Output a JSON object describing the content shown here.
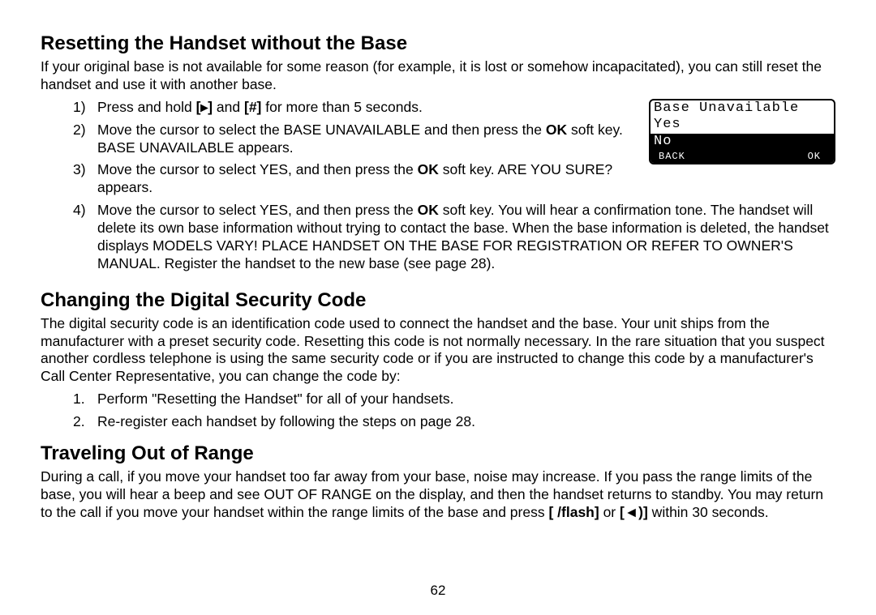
{
  "section1": {
    "heading": "Resetting the Handset without the Base",
    "intro": "If your original base is not available for some reason (for example, it is lost or somehow incapacitated), you can still reset the handset and use it with another base.",
    "steps": [
      {
        "num": "1)",
        "pre": "Press and hold ",
        "icon1": "[▸]",
        "mid": " and ",
        "icon2": "[#]",
        "post": " for more than 5 seconds."
      },
      {
        "num": "2)",
        "text_a": "Move the cursor to select the BASE UNAVAILABLE and then press the ",
        "bold_a": "OK",
        "text_b": " soft key. BASE UNAVAILABLE appears."
      },
      {
        "num": "3)",
        "text_a": "Move the cursor to select YES, and then press the ",
        "bold_a": "OK",
        "text_b": " soft key. ARE YOU SURE? appears."
      },
      {
        "num": "4)",
        "text_a": "Move the cursor to select YES, and then press the ",
        "bold_a": "OK",
        "text_b": " soft key. You will hear a confirmation tone. The handset will delete its own base information without trying to contact the base. When the base information is deleted, the handset displays MODELS VARY! PLACE HANDSET ON THE BASE FOR REGISTRATION OR REFER TO OWNER'S MANUAL. Register the handset to the new base (see page 28)."
      }
    ]
  },
  "lcd": {
    "line1": "Base Unavailable",
    "line2": "Yes",
    "line3": "No",
    "soft_left": "BACK",
    "soft_right": "OK"
  },
  "section2": {
    "heading": "Changing the Digital Security Code",
    "intro": "The digital security code is an identification code used to connect the handset and the base. Your unit ships from the manufacturer with a preset security code. Resetting this code is not normally necessary. In the rare situation that you suspect another cordless telephone is using the same security code or if you are instructed to change this code by a manufacturer's Call Center Representative, you can change the code by:",
    "steps": [
      {
        "num": "1.",
        "text": "Perform \"Resetting the Handset\" for all of your handsets."
      },
      {
        "num": "2.",
        "text": "Re-register each handset by following the steps on page 28."
      }
    ]
  },
  "section3": {
    "heading": "Traveling Out of Range",
    "body_a": "During a call, if you move your handset too far away from your base, noise may increase. If you pass the range limits of the base, you will hear a beep and see OUT OF RANGE on the display, and then the handset returns to standby. You may return to the call if you move your handset within the range limits of the base and press ",
    "icon1": "[ /flash]",
    "body_b": " or ",
    "icon2": "[◄)]",
    "body_c": " within 30 seconds."
  },
  "page_number": "62"
}
